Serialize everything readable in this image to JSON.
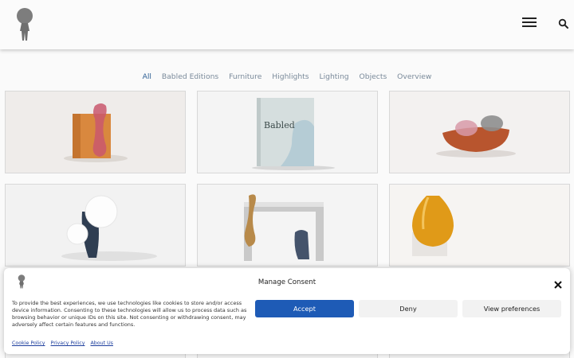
{
  "header": {
    "logo": "site-logo-figure",
    "menu_icon": "hamburger-menu-icon",
    "search_icon": "search-icon"
  },
  "filters": {
    "items": [
      "All",
      "Babled Editions",
      "Furniture",
      "Highlights",
      "Lighting",
      "Objects",
      "Overview"
    ],
    "active": "All"
  },
  "grid": {
    "tiles": [
      {
        "image": "wooden-block-with-pink-glass-vase"
      },
      {
        "image": "babled-book-cover",
        "book_title": "Babled"
      },
      {
        "image": "wooden-bowl-with-glass-bubbles"
      },
      {
        "image": "dark-glass-lamp-with-white-spheres"
      },
      {
        "image": "marble-console-with-amber-glass"
      },
      {
        "image": "amber-glass-vessel-on-marble"
      }
    ]
  },
  "consent": {
    "title": "Manage Consent",
    "text": "To provide the best experiences, we use technologies like cookies to store and/or access device information. Consenting to these technologies will allow us to process data such as browsing behavior or unique IDs on this site. Not consenting or withdrawing consent, may adversely affect certain features and functions.",
    "accept_label": "Accept",
    "deny_label": "Deny",
    "preferences_label": "View preferences",
    "links": [
      "Cookie Policy",
      "Privacy Policy",
      "About Us"
    ],
    "accept_color": "#1e5bb6"
  }
}
